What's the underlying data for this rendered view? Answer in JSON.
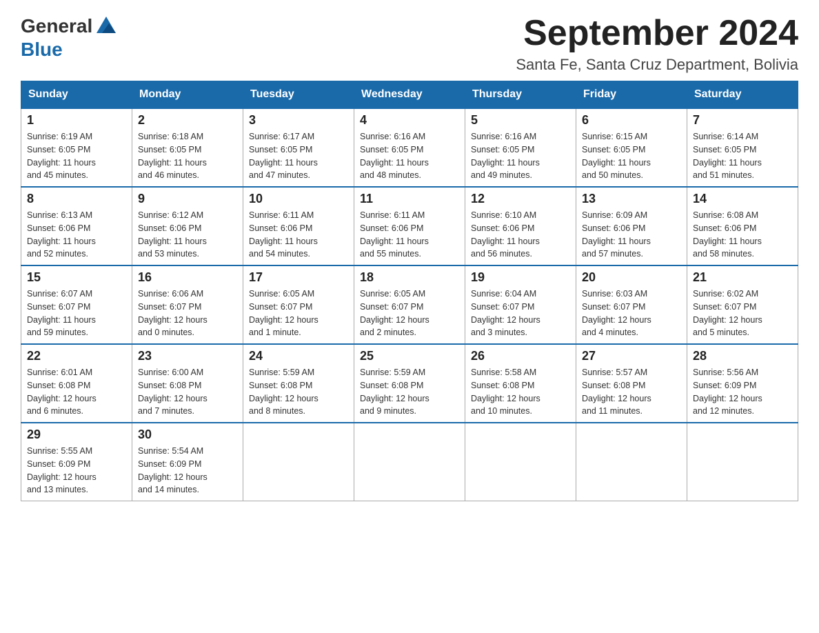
{
  "header": {
    "logo_general": "General",
    "logo_blue": "Blue",
    "month_title": "September 2024",
    "location": "Santa Fe, Santa Cruz Department, Bolivia"
  },
  "days_of_week": [
    "Sunday",
    "Monday",
    "Tuesday",
    "Wednesday",
    "Thursday",
    "Friday",
    "Saturday"
  ],
  "weeks": [
    [
      {
        "day": "1",
        "info": "Sunrise: 6:19 AM\nSunset: 6:05 PM\nDaylight: 11 hours\nand 45 minutes."
      },
      {
        "day": "2",
        "info": "Sunrise: 6:18 AM\nSunset: 6:05 PM\nDaylight: 11 hours\nand 46 minutes."
      },
      {
        "day": "3",
        "info": "Sunrise: 6:17 AM\nSunset: 6:05 PM\nDaylight: 11 hours\nand 47 minutes."
      },
      {
        "day": "4",
        "info": "Sunrise: 6:16 AM\nSunset: 6:05 PM\nDaylight: 11 hours\nand 48 minutes."
      },
      {
        "day": "5",
        "info": "Sunrise: 6:16 AM\nSunset: 6:05 PM\nDaylight: 11 hours\nand 49 minutes."
      },
      {
        "day": "6",
        "info": "Sunrise: 6:15 AM\nSunset: 6:05 PM\nDaylight: 11 hours\nand 50 minutes."
      },
      {
        "day": "7",
        "info": "Sunrise: 6:14 AM\nSunset: 6:05 PM\nDaylight: 11 hours\nand 51 minutes."
      }
    ],
    [
      {
        "day": "8",
        "info": "Sunrise: 6:13 AM\nSunset: 6:06 PM\nDaylight: 11 hours\nand 52 minutes."
      },
      {
        "day": "9",
        "info": "Sunrise: 6:12 AM\nSunset: 6:06 PM\nDaylight: 11 hours\nand 53 minutes."
      },
      {
        "day": "10",
        "info": "Sunrise: 6:11 AM\nSunset: 6:06 PM\nDaylight: 11 hours\nand 54 minutes."
      },
      {
        "day": "11",
        "info": "Sunrise: 6:11 AM\nSunset: 6:06 PM\nDaylight: 11 hours\nand 55 minutes."
      },
      {
        "day": "12",
        "info": "Sunrise: 6:10 AM\nSunset: 6:06 PM\nDaylight: 11 hours\nand 56 minutes."
      },
      {
        "day": "13",
        "info": "Sunrise: 6:09 AM\nSunset: 6:06 PM\nDaylight: 11 hours\nand 57 minutes."
      },
      {
        "day": "14",
        "info": "Sunrise: 6:08 AM\nSunset: 6:06 PM\nDaylight: 11 hours\nand 58 minutes."
      }
    ],
    [
      {
        "day": "15",
        "info": "Sunrise: 6:07 AM\nSunset: 6:07 PM\nDaylight: 11 hours\nand 59 minutes."
      },
      {
        "day": "16",
        "info": "Sunrise: 6:06 AM\nSunset: 6:07 PM\nDaylight: 12 hours\nand 0 minutes."
      },
      {
        "day": "17",
        "info": "Sunrise: 6:05 AM\nSunset: 6:07 PM\nDaylight: 12 hours\nand 1 minute."
      },
      {
        "day": "18",
        "info": "Sunrise: 6:05 AM\nSunset: 6:07 PM\nDaylight: 12 hours\nand 2 minutes."
      },
      {
        "day": "19",
        "info": "Sunrise: 6:04 AM\nSunset: 6:07 PM\nDaylight: 12 hours\nand 3 minutes."
      },
      {
        "day": "20",
        "info": "Sunrise: 6:03 AM\nSunset: 6:07 PM\nDaylight: 12 hours\nand 4 minutes."
      },
      {
        "day": "21",
        "info": "Sunrise: 6:02 AM\nSunset: 6:07 PM\nDaylight: 12 hours\nand 5 minutes."
      }
    ],
    [
      {
        "day": "22",
        "info": "Sunrise: 6:01 AM\nSunset: 6:08 PM\nDaylight: 12 hours\nand 6 minutes."
      },
      {
        "day": "23",
        "info": "Sunrise: 6:00 AM\nSunset: 6:08 PM\nDaylight: 12 hours\nand 7 minutes."
      },
      {
        "day": "24",
        "info": "Sunrise: 5:59 AM\nSunset: 6:08 PM\nDaylight: 12 hours\nand 8 minutes."
      },
      {
        "day": "25",
        "info": "Sunrise: 5:59 AM\nSunset: 6:08 PM\nDaylight: 12 hours\nand 9 minutes."
      },
      {
        "day": "26",
        "info": "Sunrise: 5:58 AM\nSunset: 6:08 PM\nDaylight: 12 hours\nand 10 minutes."
      },
      {
        "day": "27",
        "info": "Sunrise: 5:57 AM\nSunset: 6:08 PM\nDaylight: 12 hours\nand 11 minutes."
      },
      {
        "day": "28",
        "info": "Sunrise: 5:56 AM\nSunset: 6:09 PM\nDaylight: 12 hours\nand 12 minutes."
      }
    ],
    [
      {
        "day": "29",
        "info": "Sunrise: 5:55 AM\nSunset: 6:09 PM\nDaylight: 12 hours\nand 13 minutes."
      },
      {
        "day": "30",
        "info": "Sunrise: 5:54 AM\nSunset: 6:09 PM\nDaylight: 12 hours\nand 14 minutes."
      },
      {
        "day": "",
        "info": ""
      },
      {
        "day": "",
        "info": ""
      },
      {
        "day": "",
        "info": ""
      },
      {
        "day": "",
        "info": ""
      },
      {
        "day": "",
        "info": ""
      }
    ]
  ]
}
